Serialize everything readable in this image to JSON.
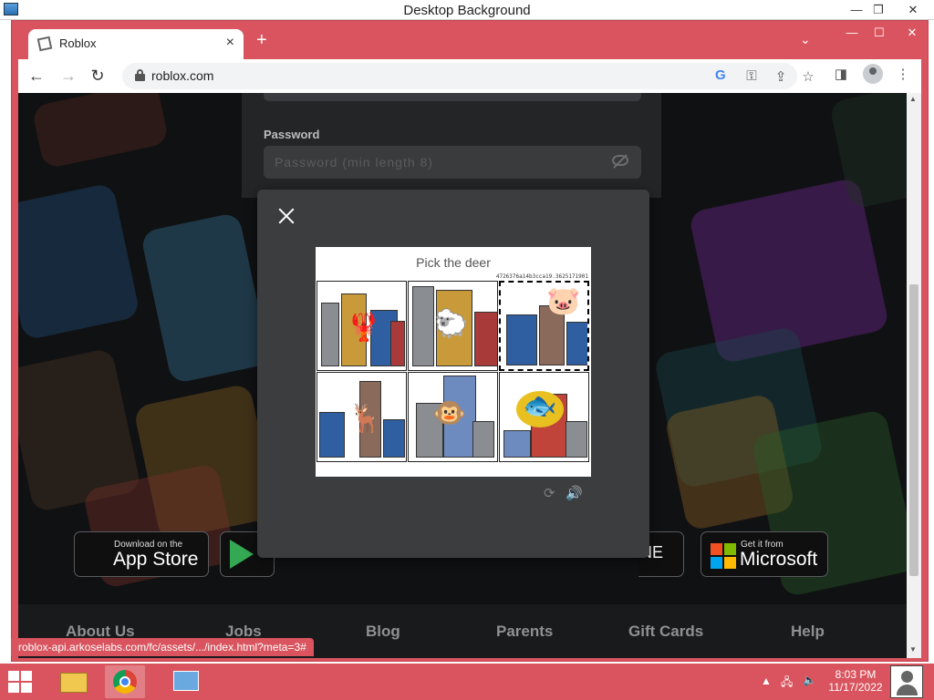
{
  "outer_window": {
    "title": "Desktop Background"
  },
  "browser": {
    "tab": {
      "title": "Roblox"
    },
    "url": "roblox.com",
    "status_url": "roblox-api.arkoselabs.com/fc/assets/.../index.html?meta=3#"
  },
  "login": {
    "password_label": "Password",
    "password_placeholder": "Password (min length 8)"
  },
  "app_buttons": {
    "apple_small": "Download on the",
    "apple_big": "App Store",
    "microsoft_small": "Get it from",
    "microsoft_big": "Microsoft",
    "partial_text": "NE"
  },
  "footer": {
    "links": [
      "About Us",
      "Jobs",
      "Blog",
      "Parents",
      "Gift Cards",
      "Help"
    ]
  },
  "captcha": {
    "prompt": "Pick the deer",
    "session_id": "4726376a14b3cca19.3625171901",
    "tiles": [
      {
        "animal": "lobster",
        "selected": false
      },
      {
        "animal": "sheep",
        "selected": false
      },
      {
        "animal": "pig",
        "selected": true
      },
      {
        "animal": "deer",
        "selected": false
      },
      {
        "animal": "monkey",
        "selected": false
      },
      {
        "animal": "fish",
        "selected": false
      }
    ]
  },
  "taskbar": {
    "time": "8:03 PM",
    "date": "11/17/2022"
  },
  "colors": {
    "chrome_frame": "#d9545e",
    "modal_bg": "#3b3d3f",
    "page_bg": "#151617"
  }
}
